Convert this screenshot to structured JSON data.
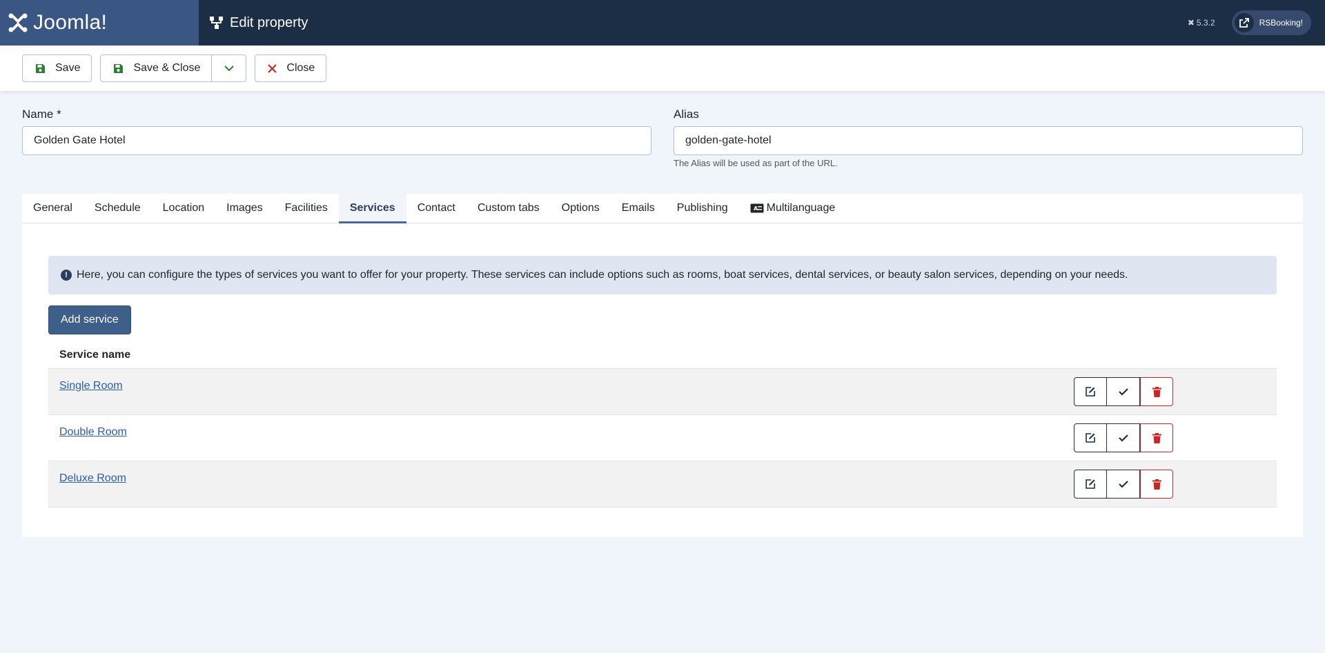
{
  "header": {
    "logo_text": "Joomla!",
    "page_title": "Edit property",
    "version": "5.3.2",
    "site_button": "RSBooking!"
  },
  "toolbar": {
    "save": "Save",
    "save_close": "Save & Close",
    "close": "Close"
  },
  "form": {
    "name_label": "Name *",
    "name_value": "Golden Gate Hotel",
    "alias_label": "Alias",
    "alias_value": "golden-gate-hotel",
    "alias_hint": "The Alias will be used as part of the URL."
  },
  "tabs": [
    "General",
    "Schedule",
    "Location",
    "Images",
    "Facilities",
    "Services",
    "Contact",
    "Custom tabs",
    "Options",
    "Emails",
    "Publishing",
    "Multilanguage"
  ],
  "active_tab": "Services",
  "services": {
    "info": "Here, you can configure the types of services you want to offer for your property. These services can include options such as rooms, boat services, dental services, or beauty salon services, depending on your needs.",
    "add_button": "Add service",
    "column_header": "Service name",
    "rows": [
      {
        "name": "Single Room"
      },
      {
        "name": "Double Room"
      },
      {
        "name": "Deluxe Room"
      }
    ]
  },
  "colors": {
    "header_bg": "#1c2d46",
    "logo_bg": "#3a5784",
    "primary": "#3e5f8a",
    "danger": "#c52827",
    "link": "#2a5db0"
  }
}
